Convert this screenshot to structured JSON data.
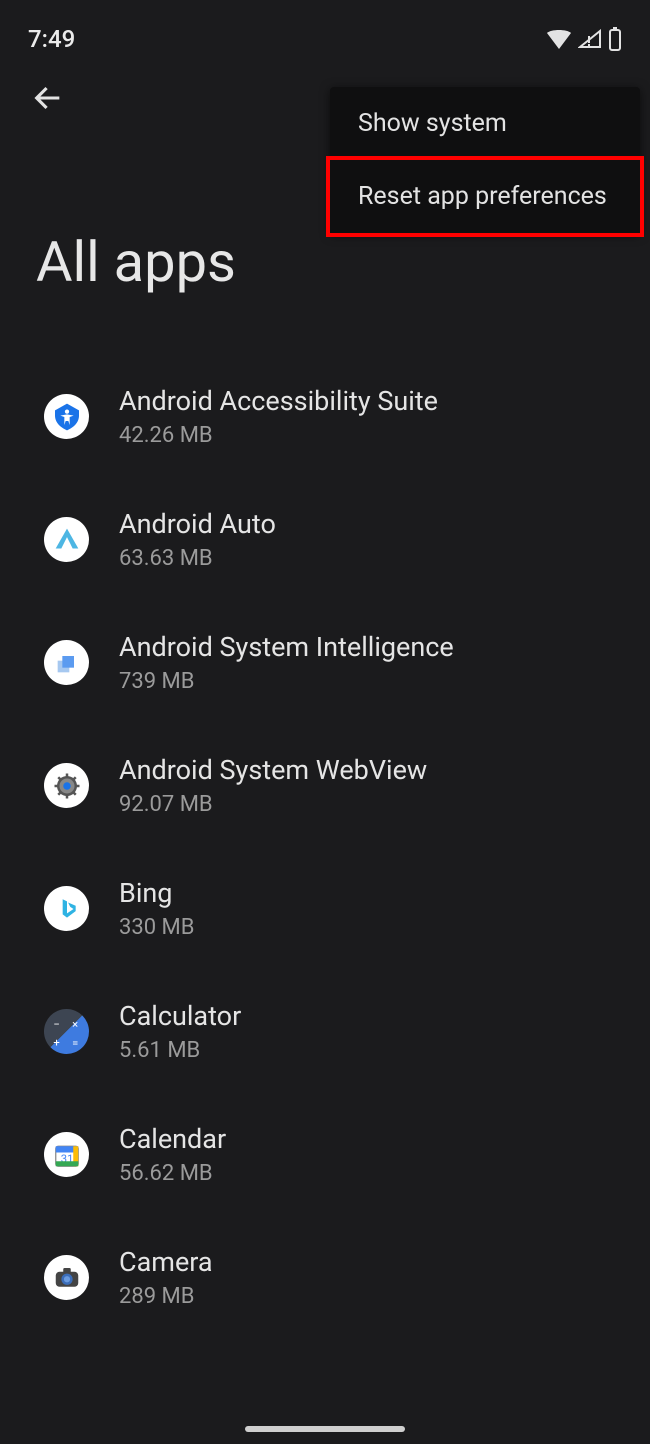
{
  "status": {
    "time": "7:49"
  },
  "title": "All apps",
  "menu": {
    "show_system": "Show system",
    "reset": "Reset app preferences"
  },
  "apps": [
    {
      "name": "Android Accessibility Suite",
      "size": "42.26 MB"
    },
    {
      "name": "Android Auto",
      "size": "63.63 MB"
    },
    {
      "name": "Android System Intelligence",
      "size": "739 MB"
    },
    {
      "name": "Android System WebView",
      "size": "92.07 MB"
    },
    {
      "name": "Bing",
      "size": "330 MB"
    },
    {
      "name": "Calculator",
      "size": "5.61 MB"
    },
    {
      "name": "Calendar",
      "size": "56.62 MB"
    },
    {
      "name": "Camera",
      "size": "289 MB"
    }
  ]
}
